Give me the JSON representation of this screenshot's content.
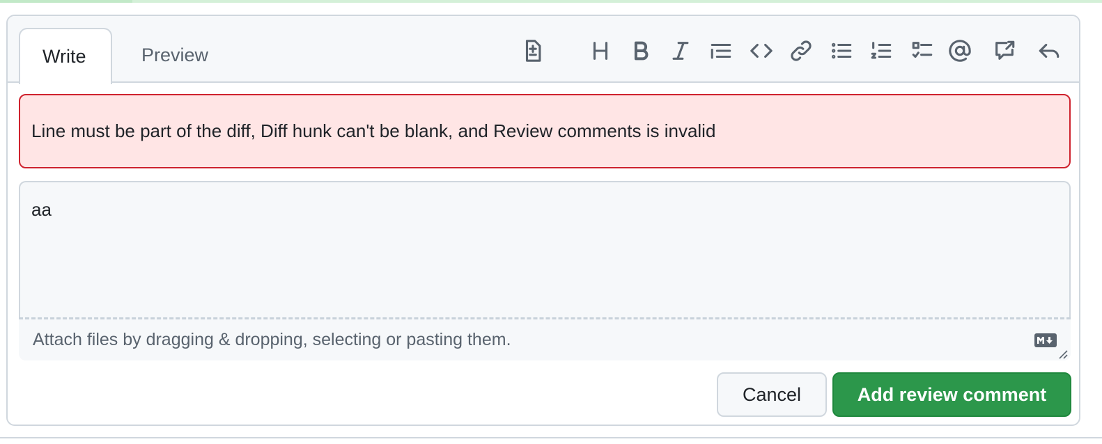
{
  "tabs": {
    "write_label": "Write",
    "preview_label": "Preview"
  },
  "toolbar": {
    "icons": [
      "diff-icon",
      "heading-icon",
      "bold-icon",
      "italic-icon",
      "quote-icon",
      "code-icon",
      "link-icon",
      "unordered-list-icon",
      "ordered-list-icon",
      "task-list-icon",
      "mention-icon",
      "cross-reference-icon",
      "reply-icon"
    ]
  },
  "error": {
    "message": "Line must be part of the diff, Diff hunk can't be blank, and Review comments is invalid",
    "color": "#cf222e"
  },
  "editor": {
    "value": "aa",
    "attach_hint": "Attach files by dragging & dropping, selecting or pasting them.",
    "markdown_icon": "markdown-icon"
  },
  "actions": {
    "cancel_label": "Cancel",
    "submit_label": "Add review comment",
    "submit_color": "#2c974b"
  }
}
